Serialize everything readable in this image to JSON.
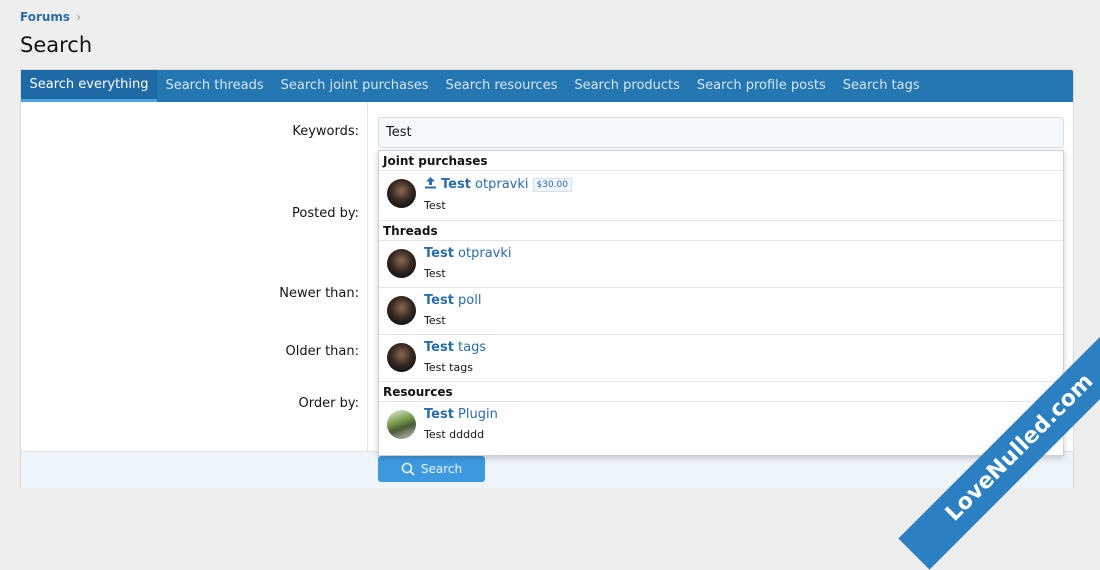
{
  "breadcrumb": {
    "item": "Forums",
    "sep": "›"
  },
  "page_title": "Search",
  "tabs": [
    "Search everything",
    "Search threads",
    "Search joint purchases",
    "Search resources",
    "Search products",
    "Search profile posts",
    "Search tags"
  ],
  "form": {
    "keywords_label": "Keywords:",
    "keywords_value": "Test",
    "posted_by_label": "Posted by:",
    "newer_than_label": "Newer than:",
    "older_than_label": "Older than:",
    "order_by_label": "Order by:",
    "search_button": "Search"
  },
  "dropdown": {
    "joint": {
      "header": "Joint purchases",
      "items": [
        {
          "bold": "Test",
          "rest": " otpravki",
          "price": "$30.00",
          "sub": "Test"
        }
      ]
    },
    "threads": {
      "header": "Threads",
      "items": [
        {
          "bold": "Test",
          "rest": " otpravki",
          "sub": "Test"
        },
        {
          "bold": "Test",
          "rest": " poll",
          "sub": "Test"
        },
        {
          "bold": "Test",
          "rest": " tags",
          "sub": "Test tags"
        }
      ]
    },
    "resources": {
      "header": "Resources",
      "items": [
        {
          "bold": "Test",
          "rest": " Plugin",
          "sub": "Test ddddd"
        }
      ]
    }
  },
  "watermark": "LoveNulled.com",
  "colors": {
    "tab_bar": "#2577b1",
    "link": "#2b6da8",
    "button": "#3d9ae0"
  }
}
